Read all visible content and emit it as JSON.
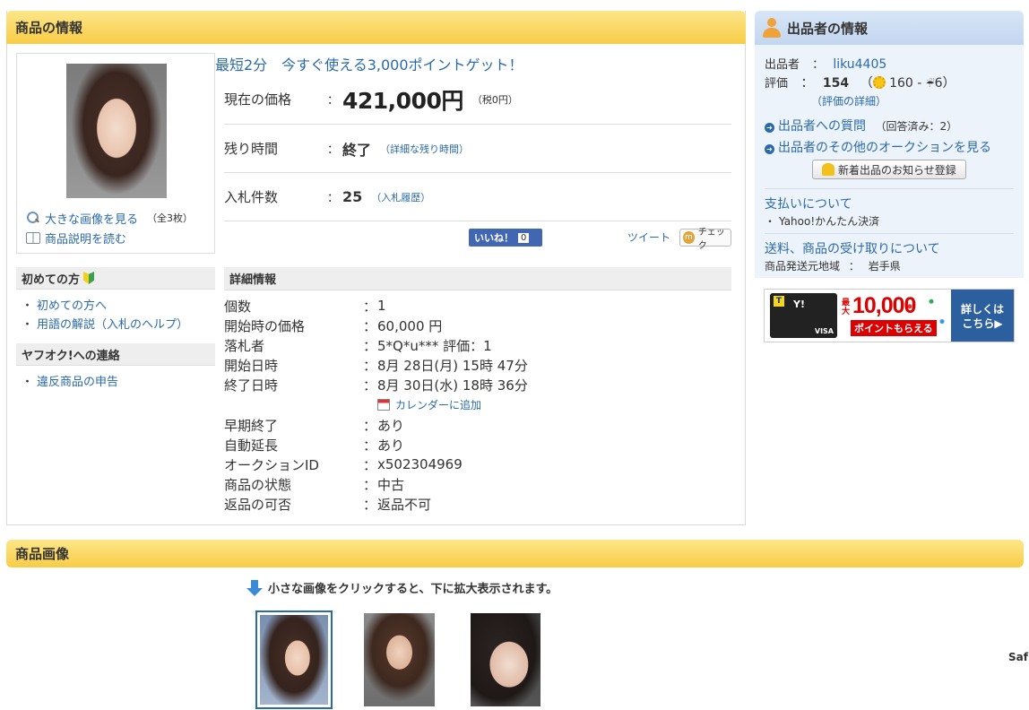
{
  "product_section": {
    "title": "商品の情報",
    "promo": "最短2分　今すぐ使える3,000ポイントゲット！",
    "thumb_links": {
      "large_image": "大きな画像を見る",
      "image_count": "（全3枚）",
      "description": "商品説明を読む"
    },
    "price": {
      "label": "現在の価格",
      "colon": "：",
      "value": "421,000円",
      "tax": "（税0円）"
    },
    "time_left": {
      "label": "残り時間",
      "value": "終了",
      "link": "（詳細な残り時間）"
    },
    "bids": {
      "label": "入札件数",
      "value": "25",
      "link": "（入札履歴）"
    },
    "social": {
      "like": "いいね！",
      "like_count": "0",
      "tweet": "ツイート",
      "check": "チェック",
      "check_mark": "m"
    }
  },
  "sidebar": {
    "beginner_title": "初めての方",
    "beginner_items": [
      "初めての方へ",
      "用語の解説（入札のヘルプ）"
    ],
    "contact_title": "ヤフオク!への連絡",
    "contact_items": [
      "違反商品の申告"
    ],
    "bullet": "・"
  },
  "details": {
    "title": "詳細情報",
    "colon": "：",
    "rows": [
      {
        "label": "個数",
        "value": "1"
      },
      {
        "label": "開始時の価格",
        "value": "60,000 円"
      },
      {
        "label": "落札者",
        "value": "5*Q*u*** 評価：1"
      },
      {
        "label": "開始日時",
        "value": "8月 28日(月) 15時 47分"
      },
      {
        "label": "終了日時",
        "value": "8月 30日(水) 18時 36分"
      }
    ],
    "calendar_link": "カレンダーに追加",
    "rows2": [
      {
        "label": "早期終了",
        "value": "あり"
      },
      {
        "label": "自動延長",
        "value": "あり"
      },
      {
        "label": "オークションID",
        "value": "x502304969"
      },
      {
        "label": "商品の状態",
        "value": "中古"
      },
      {
        "label": "返品の可否",
        "value": "返品不可"
      }
    ]
  },
  "seller": {
    "title": "出品者の情報",
    "seller_label": "出品者",
    "colon": "：",
    "seller_id": "liku4405",
    "rating_label": "評価",
    "rating_value": "154",
    "rating_open": "（",
    "rating_good": "160",
    "rating_sep": "-",
    "rating_bad": "6",
    "rating_close": "）",
    "rating_detail": "（評価の詳細）",
    "question_link": "出品者への質問",
    "question_count": "（回答済み：2）",
    "other_auctions": "出品者のその他のオークションを見る",
    "notify_button": "新着出品のお知らせ登録",
    "payment_title": "支払いについて",
    "payment_method": "Yahoo!かんたん決済",
    "shipping_title": "送料、商品の受け取りについて",
    "ship_from_label": "商品発送元地域",
    "ship_from_value": "岩手県",
    "arrow_glyph": "➜",
    "bullet": "・"
  },
  "banner": {
    "card_brand": "Y!",
    "card_network": "VISA",
    "card_badge": "T",
    "max_label": "最大",
    "amount": "10,000",
    "points": "ポイントもらえる",
    "more_line1": "詳しくは",
    "more_line2": "こちら▶"
  },
  "images_section": {
    "title": "商品画像",
    "hint": "小さな画像をクリックすると、下に拡大表示されます。"
  },
  "edge_text": "Saf"
}
